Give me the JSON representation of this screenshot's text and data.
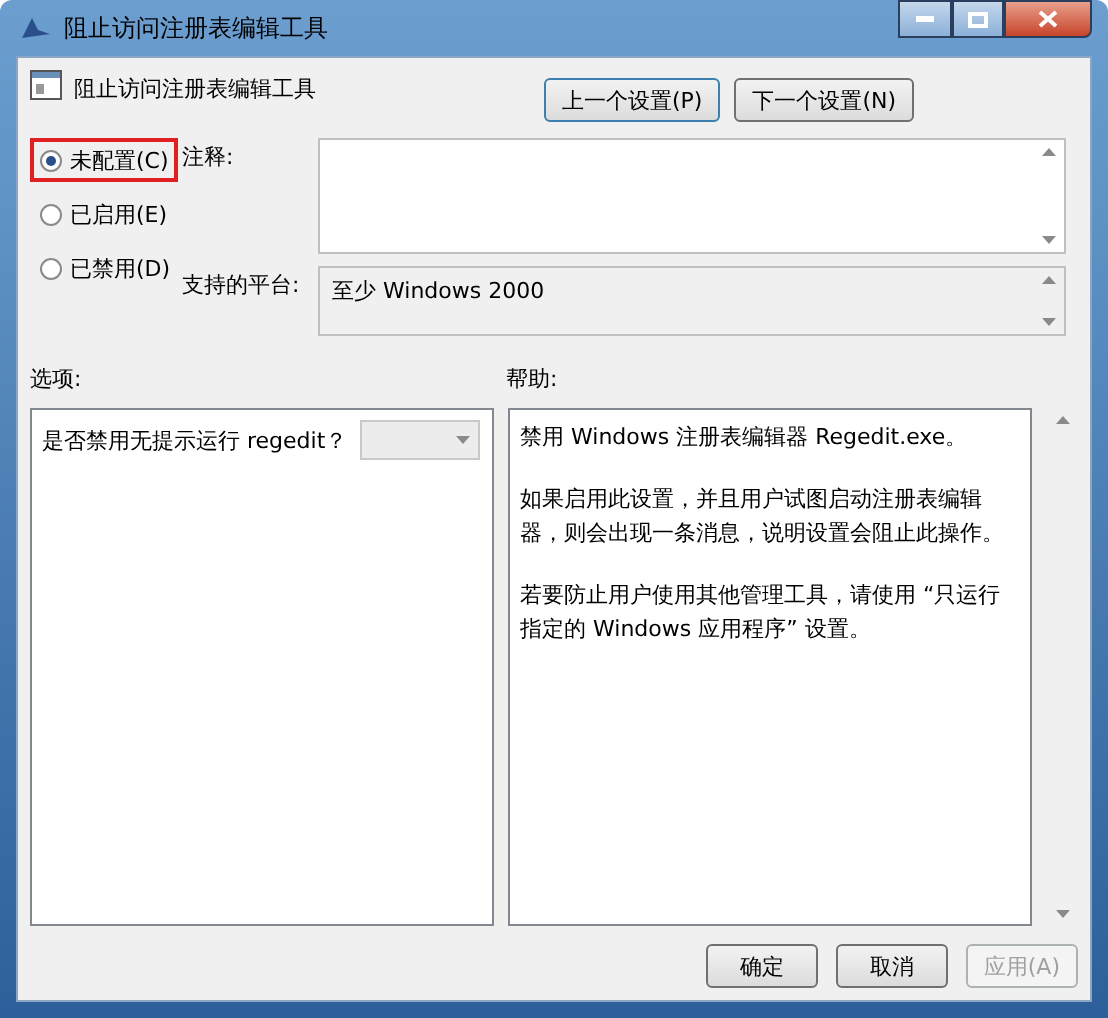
{
  "window": {
    "title": "阻止访问注册表编辑工具"
  },
  "policy_title": "阻止访问注册表编辑工具",
  "nav_buttons": [
    {
      "label": "上一个设置(P)",
      "focused": true
    },
    {
      "label": "下一个设置(N)",
      "focused": false
    }
  ],
  "states": [
    {
      "label": "未配置(C)",
      "selected": true
    },
    {
      "label": "已启用(E)",
      "selected": false
    },
    {
      "label": "已禁用(D)",
      "selected": false
    }
  ],
  "comment": {
    "label": "注释:"
  },
  "platform": {
    "label": "支持的平台:",
    "value": "至少 Windows 2000"
  },
  "options": {
    "label": "选项:",
    "question": "是否禁用无提示运行 regedit？",
    "dropdown_disabled": true
  },
  "help": {
    "label": "帮助:",
    "paragraphs": [
      "禁用 Windows 注册表编辑器 Regedit.exe。",
      "如果启用此设置，并且用户试图启动注册表编辑器，则会出现一条消息，说明设置会阻止此操作。",
      "若要防止用户使用其他管理工具，请使用 “只运行指定的 Windows 应用程序” 设置。"
    ]
  },
  "buttons": [
    {
      "label": "确定",
      "disabled": false
    },
    {
      "label": "取消",
      "disabled": false
    },
    {
      "label": "应用(A)",
      "disabled": true
    }
  ]
}
